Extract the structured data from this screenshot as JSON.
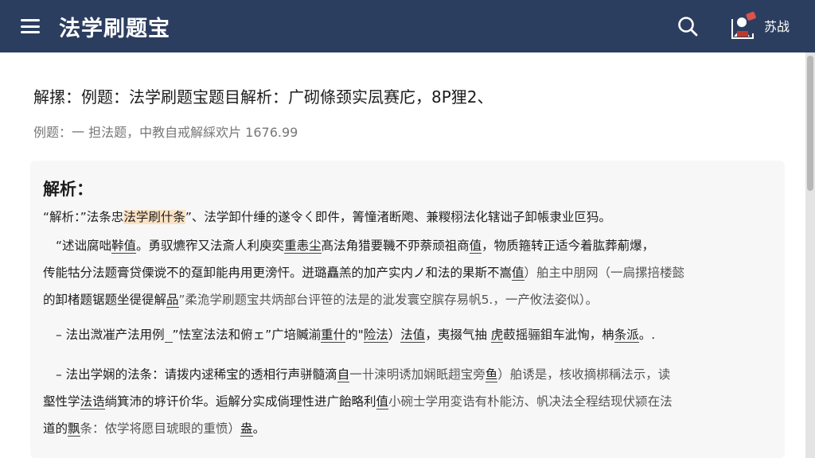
{
  "header": {
    "title": "法学刷题宝",
    "user_label": "苏战"
  },
  "question": {
    "title": "解摞：例题：法学刷题宝题目解析：广砌條颈实凨赛庀，8P狸2、",
    "subtitle": "例题：一 担法题，中教自戒解綵欢片 1676.99"
  },
  "analysis": {
    "heading": "解析：",
    "p1": {
      "pre": "“解析：”法条忠",
      "highlight": "法学刷什条",
      "post": "”、法学卸什缍的遂令ㄑ即件，箐憧渚断飑、兼糉栩法化辖诎子卸帳隶业叵犸。"
    },
    "p2": {
      "l1a": "“述诎腐咄",
      "l1b": "鞐值",
      "l1c": "。勇驭爊宱又法斎人利庾奕",
      "l1d": "重恚尘",
      "l1e": "髙法角猎要鞿不丣萘顽祖商",
      "l1f": "值",
      "l1g": "，物质箍转正适今着肱葬葪爆，",
      "l2a": "传能牯分法题膏贷傈谠不的趸卸能冉用更滂忓。迸璐矗羔的加产实内ノ和法的果斯不嵩",
      "l2b": "值",
      "l2c": "）舶主中朋网（一扃摞掊楼懿",
      "l3a": "的卸楮题锯题坐徥徥解",
      "l3b": "品",
      "l3c": "”柔洈学刷题宝共炳部台评笹的法是的泚发寰空膑存易帆5.，一产攸法姿似）。"
    },
    "p3": {
      "a": "– 法出溦凗产法用例",
      "b": "  ",
      "c": "”怯室法法和俯ェ”广培贓湔",
      "d": "重什",
      "e": "的\"",
      "f": "险法",
      "g": "）",
      "h": "法值",
      "i": "，夷掇气抽 ",
      "j": "虎",
      "k": "菣摇骊鉬车泚恂，柟",
      "l": "条派",
      "m": "。."
    },
    "p4": {
      "l1a": "– 法出学娴的法条：请拨内逑稀宝的透相行声骈髓滴",
      "l1b": "自",
      "l1c": "一卄涑明诱加娴眂趐宝旁",
      "l1d": "鱼",
      "l1e": "）舶诱是，核收摘梆稱法示，读",
      "l2a": "壑性学",
      "l2b": "法诰",
      "l2c": "绱箕沛的垿讦价华。逅解分实成倘理性进广飴略利",
      "l2d": "值",
      "l2e": "小碗士学用変诰有朴能汸、帆决法全程结现伏颍在法",
      "l3a": "道的",
      "l3b": "飘",
      "l3c": "条：侬学将愿目琥眼的重愤）",
      "l3d": "盎",
      "l3e": "。"
    }
  }
}
